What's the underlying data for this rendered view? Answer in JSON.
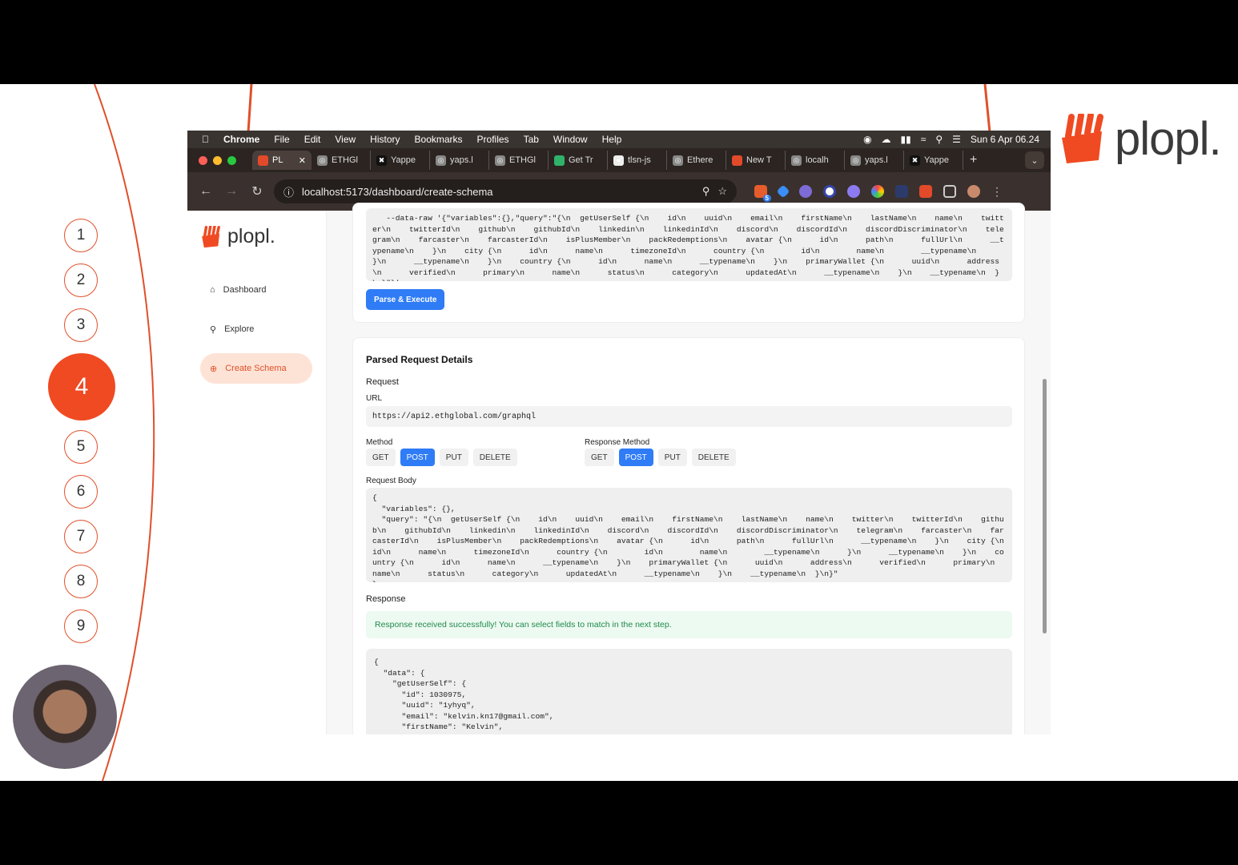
{
  "slide": {
    "brand_word": "plopl.",
    "steps": [
      "1",
      "2",
      "3",
      "4",
      "5",
      "6",
      "7",
      "8",
      "9"
    ],
    "active_step": "4",
    "accent_color": "#f04a22"
  },
  "os_menu": {
    "app": "Chrome",
    "items": [
      "File",
      "Edit",
      "View",
      "History",
      "Bookmarks",
      "Profiles",
      "Tab",
      "Window",
      "Help"
    ],
    "clock": "Sun 6 Apr  06.24"
  },
  "tabs": [
    {
      "label": "PL",
      "icon": "plopl-icon",
      "active": true
    },
    {
      "label": "ETHGl",
      "icon": "globe-icon"
    },
    {
      "label": "Yappe",
      "icon": "x-icon"
    },
    {
      "label": "yaps.l",
      "icon": "globe-icon"
    },
    {
      "label": "ETHGl",
      "icon": "globe-icon"
    },
    {
      "label": "Get Tr",
      "icon": "green-icon"
    },
    {
      "label": "tlsn-js",
      "icon": "github-icon"
    },
    {
      "label": "Ethere",
      "icon": "globe-icon"
    },
    {
      "label": "New T",
      "icon": "plopl-icon"
    },
    {
      "label": "localh",
      "icon": "globe-icon"
    },
    {
      "label": "yaps.l",
      "icon": "globe-icon"
    },
    {
      "label": "Yappe",
      "icon": "x-icon"
    }
  ],
  "browser": {
    "url": "localhost:5173/dashboard/create-schema",
    "extension_badge": "5"
  },
  "app": {
    "logo_word": "plopl.",
    "nav": [
      {
        "label": "Dashboard",
        "icon": "home-icon"
      },
      {
        "label": "Explore",
        "icon": "search-icon"
      },
      {
        "label": "Create Schema",
        "icon": "plus-circle-icon",
        "active": true
      }
    ],
    "curl_text": "   --data-raw '{\"variables\":{},\"query\":\"{\\n  getUserSelf {\\n    id\\n    uuid\\n    email\\n    firstName\\n    lastName\\n    name\\n    twitter\\n    twitterId\\n    github\\n    githubId\\n    linkedin\\n    linkedinId\\n    discord\\n    discordId\\n    discordDiscriminator\\n    telegram\\n    farcaster\\n    farcasterId\\n    isPlusMember\\n    packRedemptions\\n    avatar {\\n      id\\n      path\\n      fullUrl\\n      __typename\\n    }\\n    city {\\n      id\\n      name\\n      timezoneId\\n      country {\\n        id\\n        name\\n        __typename\\n      }\\n      __typename\\n    }\\n    country {\\n      id\\n      name\\n      __typename\\n    }\\n    primaryWallet {\\n      uuid\\n      address\\n      verified\\n      primary\\n      name\\n      status\\n      category\\n      updatedAt\\n      __typename\\n    }\\n    __typename\\n  }\\n}\"}'",
    "parse_button": "Parse & Execute",
    "parsed_title": "Parsed Request Details",
    "request_label": "Request",
    "url_label": "URL",
    "request_url": "https://api2.ethglobal.com/graphql",
    "method_label": "Method",
    "response_method_label": "Response Method",
    "methods": [
      "GET",
      "POST",
      "PUT",
      "DELETE"
    ],
    "selected_method": "POST",
    "selected_response_method": "POST",
    "request_body_label": "Request Body",
    "request_body": "{\n  \"variables\": {},\n  \"query\": \"{\\n  getUserSelf {\\n    id\\n    uuid\\n    email\\n    firstName\\n    lastName\\n    name\\n    twitter\\n    twitterId\\n    github\\n    githubId\\n    linkedin\\n    linkedinId\\n    discord\\n    discordId\\n    discordDiscriminator\\n    telegram\\n    farcaster\\n    farcasterId\\n    isPlusMember\\n    packRedemptions\\n    avatar {\\n      id\\n      path\\n      fullUrl\\n      __typename\\n    }\\n    city {\\n      id\\n      name\\n      timezoneId\\n      country {\\n        id\\n        name\\n        __typename\\n      }\\n      __typename\\n    }\\n    country {\\n      id\\n      name\\n      __typename\\n    }\\n    primaryWallet {\\n      uuid\\n      address\\n      verified\\n      primary\\n      name\\n      status\\n      category\\n      updatedAt\\n      __typename\\n    }\\n    __typename\\n  }\\n}\"\n}",
    "response_label": "Response",
    "success_message": "Response received successfully! You can select fields to match in the next step.",
    "response_json": "{\n  \"data\": {\n    \"getUserSelf\": {\n      \"id\": 1030975,\n      \"uuid\": \"1yhyq\",\n      \"email\": \"kelvin.kn17@gmail.com\",\n      \"firstName\": \"Kelvin\","
  }
}
